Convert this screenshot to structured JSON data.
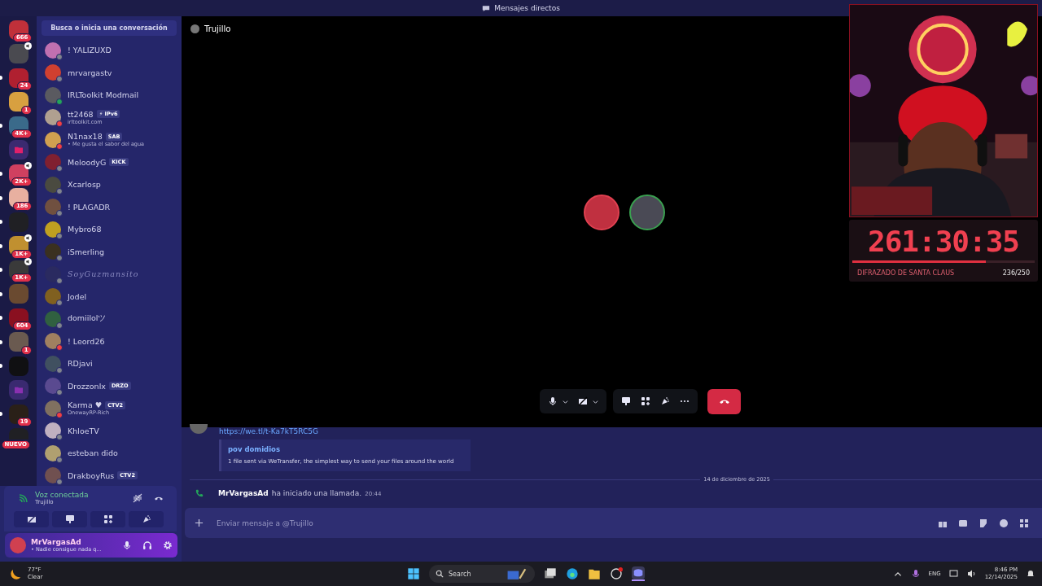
{
  "window": {
    "title": "Mensajes directos"
  },
  "servers": [
    {
      "kind": "avatar",
      "color": "#c0303a",
      "badge": "666",
      "unread": false,
      "voice": false
    },
    {
      "kind": "avatar",
      "color": "#4a4a50",
      "unread": false,
      "voice": true
    },
    {
      "kind": "avatar",
      "color": "#b02030",
      "badge": "24",
      "unread": true,
      "voice": false
    },
    {
      "kind": "avatar",
      "color": "#d8a040",
      "badge": "1",
      "unread": false,
      "voice": false
    },
    {
      "kind": "avatar",
      "color": "#3a6a8a",
      "badge": "4K+",
      "unread": true,
      "voice": false
    },
    {
      "kind": "folder",
      "color": "#e0206a",
      "unread": false,
      "voice": false
    },
    {
      "kind": "avatar",
      "color": "#d04060",
      "badge": "2K+",
      "unread": true,
      "voice": true
    },
    {
      "kind": "avatar",
      "color": "#e8b0a0",
      "badge": "186",
      "unread": true,
      "voice": false
    },
    {
      "kind": "avatar",
      "color": "#202024",
      "unread": true,
      "voice": false
    },
    {
      "kind": "avatar",
      "color": "#c09030",
      "badge": "1K+",
      "unread": true,
      "voice": true
    },
    {
      "kind": "avatar",
      "color": "#3a3a3a",
      "badge": "1K+",
      "unread": true,
      "voice": true
    },
    {
      "kind": "avatar",
      "color": "#6a4a30",
      "unread": true,
      "voice": false
    },
    {
      "kind": "avatar",
      "color": "#8a1020",
      "badge": "604",
      "unread": true,
      "voice": false
    },
    {
      "kind": "avatar",
      "color": "#6a5a50",
      "badge": "1",
      "unread": true,
      "voice": false
    },
    {
      "kind": "avatar",
      "color": "#101012",
      "unread": true,
      "voice": false
    },
    {
      "kind": "folder",
      "color": "#8a30b0",
      "unread": false,
      "voice": false
    },
    {
      "kind": "avatar",
      "color": "#2a2018",
      "badge": "19",
      "unread": true,
      "voice": false
    },
    {
      "kind": "avatar",
      "color": "#202024",
      "badge": "NUEVO",
      "unread": false,
      "voice": false
    }
  ],
  "search": {
    "placeholder": "Busca o inicia una conversación"
  },
  "dms": [
    {
      "name": "! YALIZUXD",
      "color": "#80848e",
      "dimmed": false
    },
    {
      "name": "mrvargastv",
      "color": "#80848e",
      "dimmed": false
    },
    {
      "name": "IRLToolkit Modmail",
      "color": "#23a55a",
      "dimmed": false
    },
    {
      "name": "tt2468",
      "tag": "⚡ IPv6",
      "subtitle": "irltoolkit.com",
      "color": "#f23f43",
      "dimmed": false
    },
    {
      "name": "N1nax18",
      "tag": "SAB",
      "subtitle": "• Me gusta el sabor del agua",
      "color": "#f23f43",
      "dimmed": false
    },
    {
      "name": "MeloodyG",
      "tag": "KICK",
      "color": "#80848e",
      "dimmed": false
    },
    {
      "name": "Xcarlosp",
      "color": "#80848e",
      "dimmed": false
    },
    {
      "name": "! PLAGADR",
      "color": "#80848e",
      "dimmed": false
    },
    {
      "name": "Mybro68",
      "color": "#80848e",
      "dimmed": false
    },
    {
      "name": "iSmerling",
      "color": "#80848e",
      "dimmed": false
    },
    {
      "name": "SoyGuzmansito",
      "color": "#80848e",
      "dimmed": true
    },
    {
      "name": "Jodel",
      "color": "#80848e",
      "dimmed": false
    },
    {
      "name": "domiilolツ",
      "color": "#80848e",
      "dimmed": false
    },
    {
      "name": "! Leord26",
      "color": "#f23f43",
      "dimmed": false
    },
    {
      "name": "RDjavi",
      "color": "#80848e",
      "dimmed": false
    },
    {
      "name": "Drozzonlx",
      "tag": "DRZO",
      "color": "#80848e",
      "dimmed": false
    },
    {
      "name": "Karma ♥",
      "tag": "CTV2",
      "subtitle": "OnewayRP-Rich",
      "color": "#f23f43",
      "dimmed": false
    },
    {
      "name": "KhloeTV",
      "color": "#80848e",
      "dimmed": false
    },
    {
      "name": "esteban dido",
      "color": "#80848e",
      "dimmed": false
    },
    {
      "name": "DrakboyRus",
      "tag": "CTV2",
      "color": "#80848e",
      "dimmed": false
    }
  ],
  "voice": {
    "status": "Voz conectada",
    "channel": "Trujillo"
  },
  "user": {
    "name": "MrVargasAd",
    "status": "• Nadie consigue nada q..."
  },
  "call": {
    "title": "Trujillo",
    "participants": [
      {
        "color": "#e04050"
      },
      {
        "color": "#3aa050"
      }
    ]
  },
  "messages": {
    "link": "https://we.tl/t-Ka7kT5RC5G",
    "embed": {
      "title": "pov domidios",
      "description": "1 file sent via WeTransfer, the simplest way to send your files around the world"
    },
    "date": "14 de diciembre de 2025",
    "call_event": {
      "author": "MrVargasAd",
      "text": "ha iniciado una llamada.",
      "time": "20:44"
    }
  },
  "composer": {
    "placeholder": "Enviar mensaje a @Trujillo"
  },
  "overlay": {
    "timer": "261:30:35",
    "level": 0.73,
    "goal": "DIFRAZADO DE SANTA CLAUS",
    "count": "236/250"
  },
  "taskbar": {
    "temperature": "77°F",
    "weather": "Clear",
    "search": "Search",
    "language": "ENG",
    "time": "8:46 PM",
    "date": "12/14/2025"
  }
}
